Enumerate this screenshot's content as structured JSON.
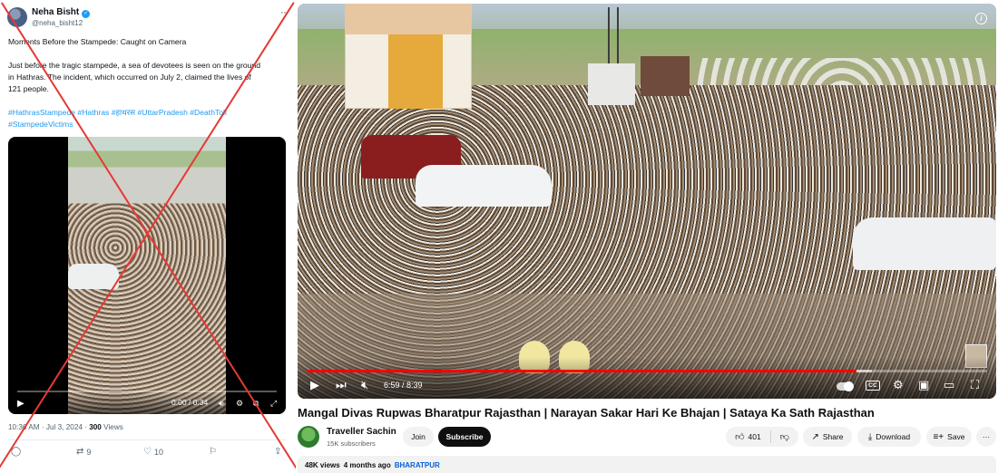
{
  "tweet": {
    "author_name": "Neha Bisht",
    "handle": "@neha_bisht12",
    "more_icon": "more-dots-icon",
    "text_heading": "Moments Before the Stampede: Caught on Camera",
    "text_line1": "Just before the tragic stampede, a sea of devotees is seen on the ground",
    "text_line2": "in Hathras. The incident, which occurred on July 2, claimed the lives of",
    "text_line3": "121 people.",
    "hashtags_line1": "#HathrasStampede #Hathras #हाथरस #UttarPradesh #DeathToll",
    "hashtags_line2": "#StampedeVictims",
    "video": {
      "time": "0:00 / 0:34"
    },
    "timestamp": "10:36 AM · Jul 3, 2024 · ",
    "views_count": "300",
    "views_label": " Views",
    "actions": {
      "retweets": "9",
      "likes": "10"
    },
    "overlay_color": "#e53935"
  },
  "youtube": {
    "player": {
      "time": "6:59 / 8:39",
      "progress_fraction": 0.808,
      "buffer_fraction": 0.83
    },
    "title": "Mangal Divas Rupwas Bharatpur Rajasthan | Narayan Sakar Hari Ke Bhajan | Sataya Ka Sath Rajasthan",
    "channel": {
      "name": "Traveller Sachin",
      "subscribers": "15K subscribers"
    },
    "join_label": "Join",
    "subscribe_label": "Subscribe",
    "like_count": "401",
    "share_label": "Share",
    "download_label": "Download",
    "save_label": "Save",
    "description": {
      "views": "48K views",
      "age": "4 months ago",
      "location": "BHARATPUR"
    },
    "accent": "#ff0000"
  }
}
